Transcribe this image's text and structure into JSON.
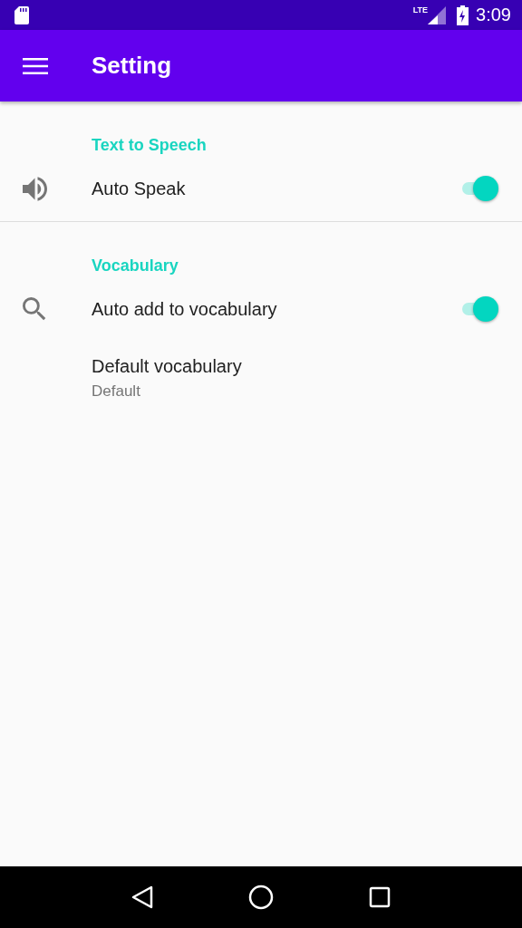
{
  "status_bar": {
    "network": "LTE",
    "time": "3:09"
  },
  "app_bar": {
    "title": "Setting"
  },
  "sections": [
    {
      "header": "Text to Speech",
      "items": [
        {
          "kind": "switch",
          "title": "Auto Speak",
          "on": true
        }
      ]
    },
    {
      "header": "Vocabulary",
      "items": [
        {
          "kind": "switch",
          "title": "Auto add to vocabulary",
          "on": true
        },
        {
          "kind": "value",
          "title": "Default vocabulary",
          "summary": "Default"
        }
      ]
    }
  ]
}
